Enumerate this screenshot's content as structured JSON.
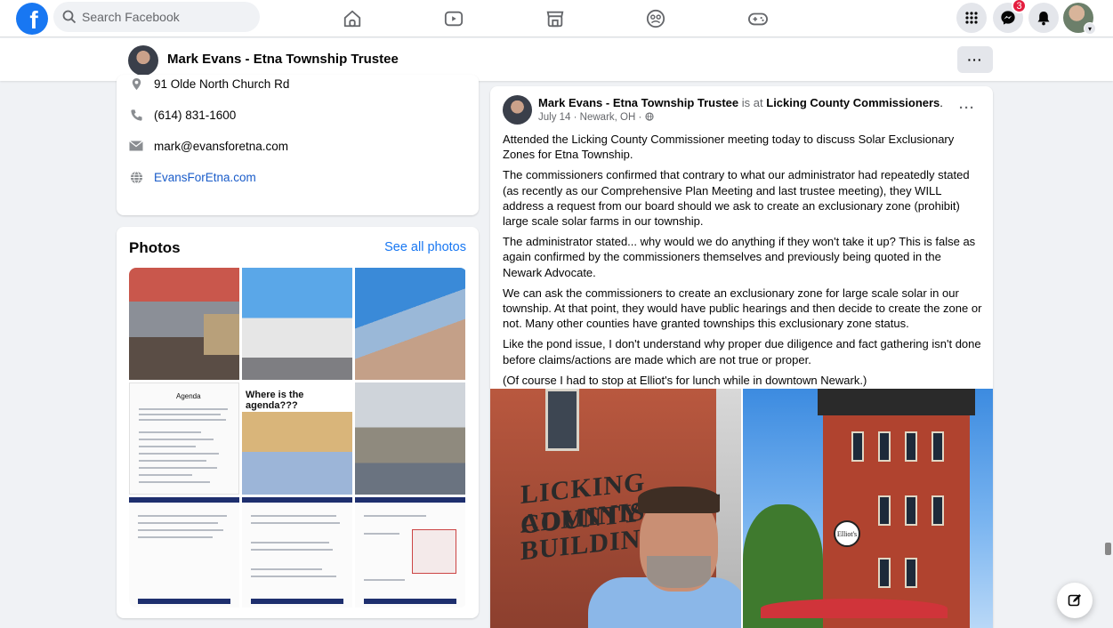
{
  "topnav": {
    "logo_letter": "f",
    "search_placeholder": "Search Facebook",
    "nav_icons": [
      "home-icon",
      "video-icon",
      "marketplace-icon",
      "groups-icon",
      "gaming-icon"
    ],
    "messenger_badge": "3"
  },
  "page_header": {
    "name": "Mark Evans - Etna Township Trustee",
    "more_label": "···"
  },
  "intro": {
    "address": "91 Olde North Church Rd",
    "phone": "(614) 831-1600",
    "email": "mark@evansforetna.com",
    "website": "EvansForEtna.com"
  },
  "photos": {
    "title": "Photos",
    "see_all": "See all photos",
    "tile_texts": {
      "agenda_heading": "Agenda",
      "agenda_question": "Where is the agenda???"
    }
  },
  "post": {
    "author": "Mark Evans - Etna Township Trustee",
    "is_at": "is at",
    "place": "Licking County Commissioners",
    "date": "July 14",
    "location": "Newark, OH",
    "more_label": "···",
    "paragraphs": [
      "Attended the Licking County Commissioner meeting today to discuss Solar Exclusionary Zones for Etna Township.",
      "The commissioners confirmed that contrary to what our administrator had repeatedly stated (as recently as our Comprehensive Plan Meeting and last trustee meeting), they WILL address a request from our board should we ask to create an exclusionary zone (prohibit) large scale solar farms in our township.",
      "The administrator stated... why would we do anything if they won't take it up? This is false as again confirmed by the commissioners themselves and previously being quoted in the Newark Advocate.",
      "We can ask the commissioners to create an exclusionary zone for large scale solar in our township. At that point, they would have public hearings and then decide to create the zone or not. Many other counties have granted townships this exclusionary zone status.",
      "Like the pond issue, I don't understand why proper due diligence and fact gathering isn't done before claims/actions are made which are not true or proper.",
      "(Of course I had to stop at Elliot's for lunch while in downtown Newark.)"
    ],
    "photo1_sign": [
      "LICKING COUNTY",
      "ADMINISTRAT",
      "BUILDING"
    ],
    "photo2_logo": "Elliot's"
  },
  "colors": {
    "brand": "#1877f2",
    "link": "#1a5cc9",
    "badge": "#e41e3f"
  }
}
